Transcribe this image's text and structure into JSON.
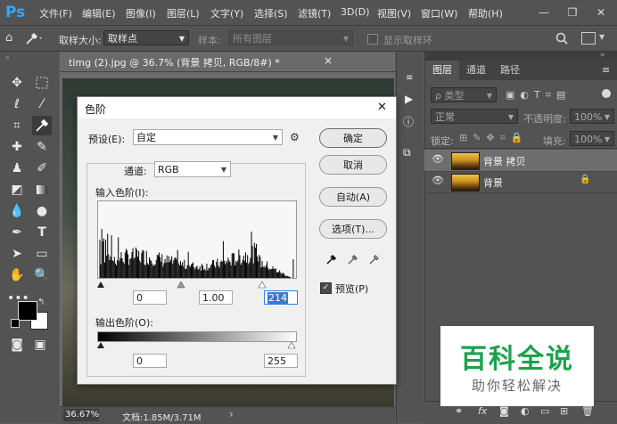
{
  "app": {
    "logo": "Ps"
  },
  "menubar": {
    "items": [
      "文件(F)",
      "编辑(E)",
      "图像(I)",
      "图层(L)",
      "文字(Y)",
      "选择(S)",
      "滤镜(T)",
      "3D(D)",
      "视图(V)",
      "窗口(W)",
      "帮助(H)"
    ],
    "window_controls": [
      "—",
      "❐",
      "✕"
    ]
  },
  "options_bar": {
    "sample_size_label": "取样大小:",
    "sample_size_value": "取样点",
    "sample_label": "样本:",
    "sample_value": "所有图层",
    "show_ring_label": "显示取样环"
  },
  "document": {
    "tab_title": "timg (2).jpg @ 36.7% (背景 拷贝, RGB/8#) *",
    "close_glyph": "×",
    "zoom": "36.67%",
    "doc_info": "文档:1.85M/3.71M",
    "arrow": "›"
  },
  "layers_panel": {
    "tabs": [
      "图层",
      "通道",
      "路径"
    ],
    "filter_label": "ρ 类型",
    "blend_mode": "正常",
    "opacity_label": "不透明度:",
    "opacity_value": "100%",
    "lock_label": "锁定:",
    "fill_label": "填充:",
    "fill_value": "100%",
    "layers": [
      {
        "name": "背景 拷贝",
        "selected": true,
        "locked": false
      },
      {
        "name": "背景",
        "selected": false,
        "locked": true
      }
    ],
    "bottom_icons": [
      "link-icon",
      "fx-icon",
      "mask-icon",
      "adjustment-icon",
      "group-icon",
      "new-layer-icon",
      "trash-icon"
    ]
  },
  "dialog": {
    "title": "色阶",
    "close": "✕",
    "preset_label": "预设(E):",
    "preset_value": "自定",
    "channel_label": "通道:",
    "channel_value": "RGB",
    "input_levels_label": "输入色阶(I):",
    "input_values": {
      "shadow": "0",
      "midtone": "1.00",
      "highlight": "214"
    },
    "output_levels_label": "输出色阶(O):",
    "output_values": {
      "shadow": "0",
      "highlight": "255"
    },
    "buttons": {
      "ok": "确定",
      "cancel": "取消",
      "auto": "自动(A)",
      "options": "选项(T)..."
    },
    "preview_label": "预览(P)",
    "preview_checked": true
  },
  "watermark": {
    "title": "百科全说",
    "subtitle": "助你轻松解决",
    "title_color": "#1aa34a"
  }
}
